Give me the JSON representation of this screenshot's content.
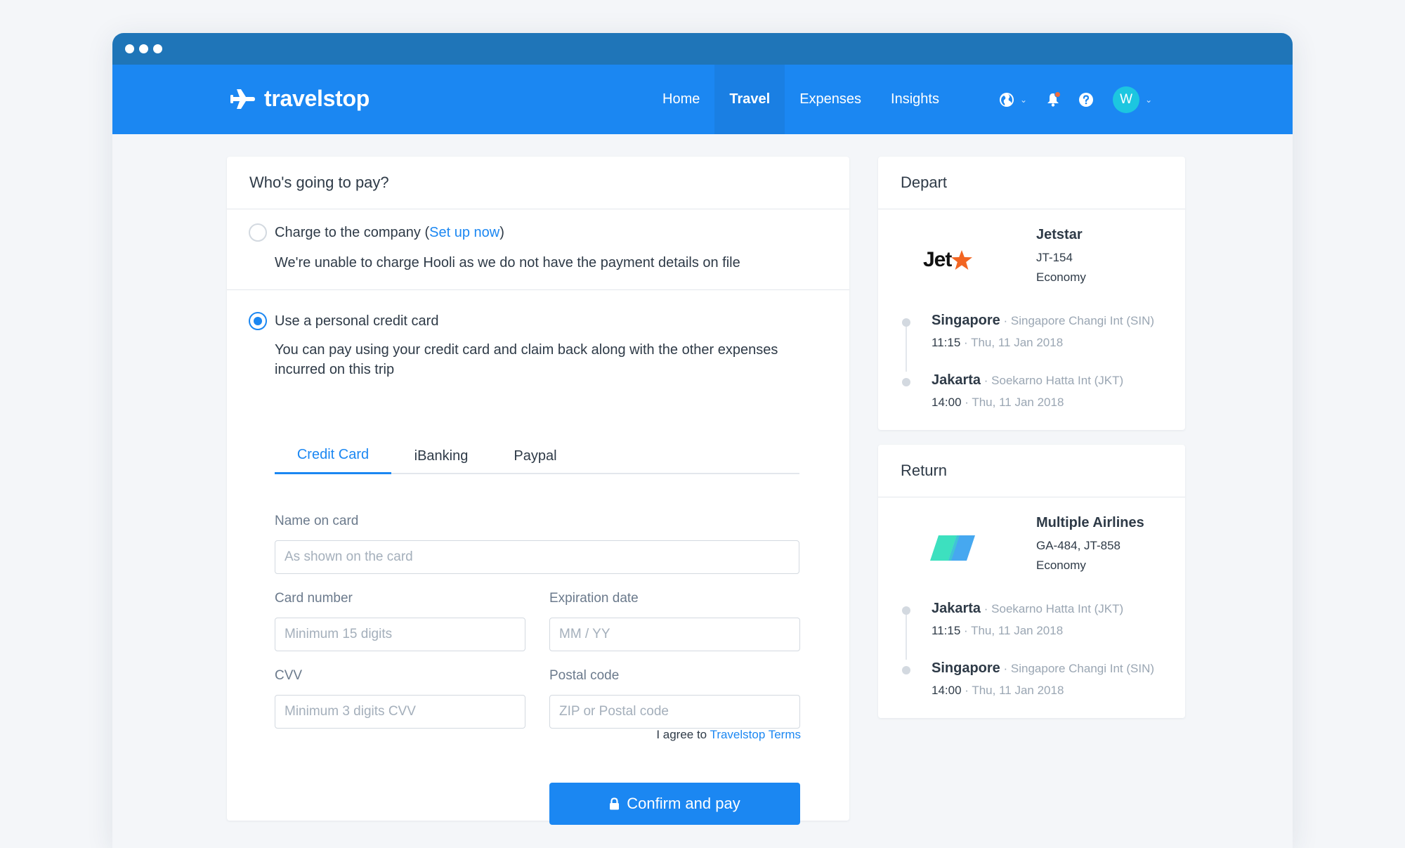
{
  "brand": {
    "name": "travelstop"
  },
  "nav": {
    "items": [
      "Home",
      "Travel",
      "Expenses",
      "Insights"
    ],
    "active": "Travel"
  },
  "user": {
    "initial": "W"
  },
  "payment": {
    "heading": "Who's going to pay?",
    "company_option": {
      "title_prefix": "Charge to the company (",
      "link": "Set up now",
      "title_suffix": ")",
      "description": "We're unable to charge Hooli as we do not have the payment details on file"
    },
    "personal_option": {
      "title": "Use a personal credit card",
      "description": "You can pay using your credit card and claim back along with the other expenses incurred on this trip"
    },
    "tabs": [
      "Credit Card",
      "iBanking",
      "Paypal"
    ],
    "fields": {
      "name_label": "Name on card",
      "name_placeholder": "As shown on the card",
      "card_label": "Card number",
      "card_placeholder": "Minimum 15 digits",
      "exp_label": "Expiration date",
      "exp_placeholder": "MM / YY",
      "cvv_label": "CVV",
      "cvv_placeholder": "Minimum 3 digits CVV",
      "postal_label": "Postal code",
      "postal_placeholder": "ZIP or Postal code"
    },
    "agree_prefix": "I agree to ",
    "agree_link": "Travelstop Terms",
    "confirm_label": "Confirm and pay"
  },
  "depart": {
    "heading": "Depart",
    "airline": "Jetstar",
    "flight": "JT-154",
    "cabin": "Economy",
    "logo_text": "Jet",
    "legs": [
      {
        "city": "Singapore",
        "airport": " · Singapore Changi Int (SIN)",
        "time": "11:15",
        "date": " · Thu, 11 Jan 2018"
      },
      {
        "city": "Jakarta",
        "airport": " · Soekarno Hatta Int (JKT)",
        "time": "14:00",
        "date": " · Thu, 11 Jan 2018"
      }
    ]
  },
  "return": {
    "heading": "Return",
    "airline": "Multiple Airlines",
    "flight": "GA-484, JT-858",
    "cabin": "Economy",
    "legs": [
      {
        "city": "Jakarta",
        "airport": " · Soekarno Hatta Int (JKT)",
        "time": "11:15",
        "date": " · Thu, 11 Jan 2018"
      },
      {
        "city": "Singapore",
        "airport": " · Singapore Changi Int (SIN)",
        "time": "14:00",
        "date": " · Thu, 11 Jan 2018"
      }
    ]
  },
  "colors": {
    "primary": "#1b87f2",
    "titlebar": "#1f75b8",
    "jetstar_orange": "#f26522",
    "avatar": "#1cc6e0"
  }
}
